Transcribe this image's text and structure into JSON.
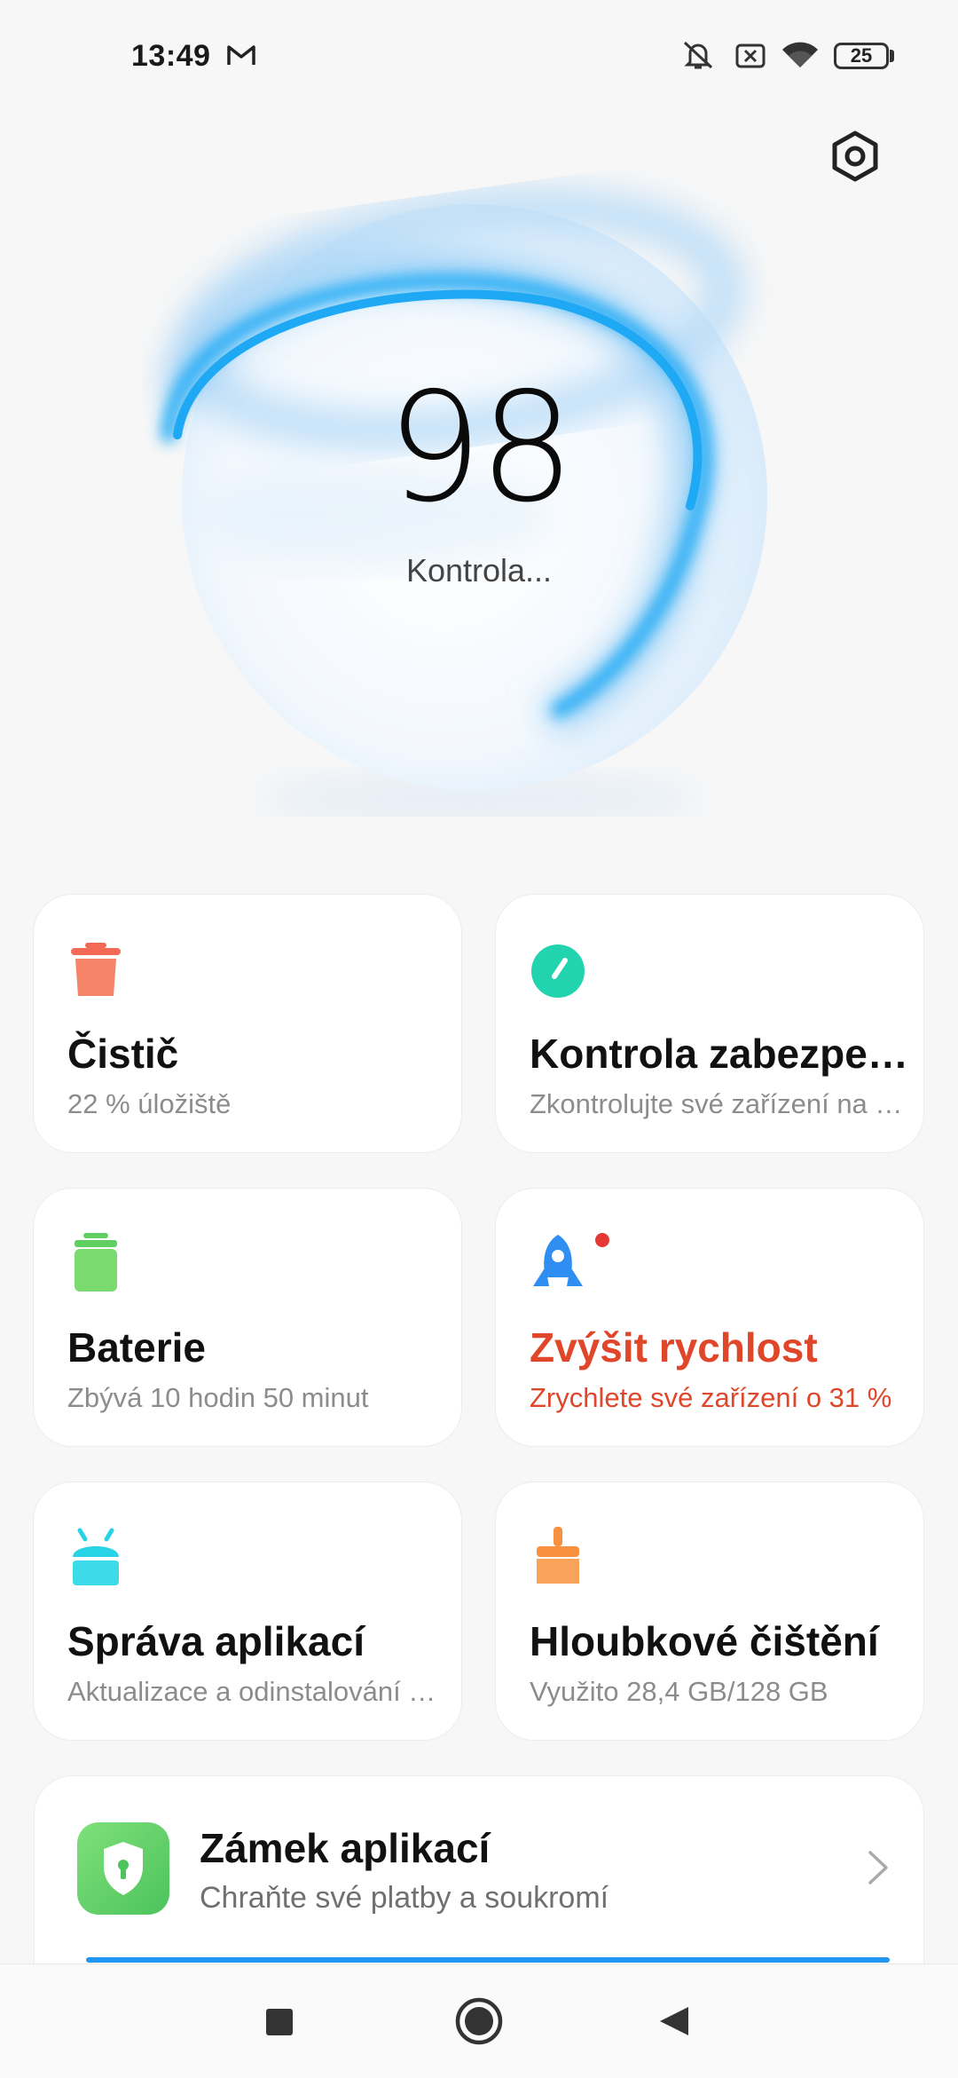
{
  "status_bar": {
    "time": "13:49",
    "battery": "25",
    "icons": [
      "gmail-icon",
      "silent-icon",
      "sim-x-icon",
      "wifi-icon",
      "battery-icon"
    ]
  },
  "header": {
    "settings_icon": "settings-icon"
  },
  "hero": {
    "score": "98",
    "status": "Kontrola...",
    "accent_color": "#29aef5"
  },
  "cards": [
    {
      "title": "Čistič",
      "subtitle": "22 % úložiště",
      "icon": "trash-icon",
      "color": "#f26a55"
    },
    {
      "title": "Kontrola zabezpečení",
      "subtitle": "Zkontrolujte své zařízení na viry",
      "icon": "security-check-icon",
      "color": "#22d3b0"
    },
    {
      "title": "Baterie",
      "subtitle": "Zbývá 10 hodin 50 minut",
      "icon": "battery-icon",
      "color": "#5fcf62"
    },
    {
      "title": "Zvýšit rychlost",
      "subtitle": "Zrychlete své zařízení o 31 %",
      "icon": "rocket-icon",
      "color": "#2e8ef2",
      "alert_color": "#e0462a"
    },
    {
      "title": "Správa aplikací",
      "subtitle": "Aktualizace a odinstalování aplikací",
      "icon": "android-icon",
      "color": "#29d3e6"
    },
    {
      "title": "Hloubkové čištění",
      "subtitle": "Využito 28,4 GB/128 GB",
      "icon": "brush-icon",
      "color": "#f7913f"
    }
  ],
  "app_lock": {
    "title": "Zámek aplikací",
    "subtitle": "Chraňte své platby a soukromí",
    "icon": "shield-lock-icon"
  },
  "nav_bar": {
    "buttons": [
      "recents-button",
      "home-button",
      "back-button"
    ]
  }
}
